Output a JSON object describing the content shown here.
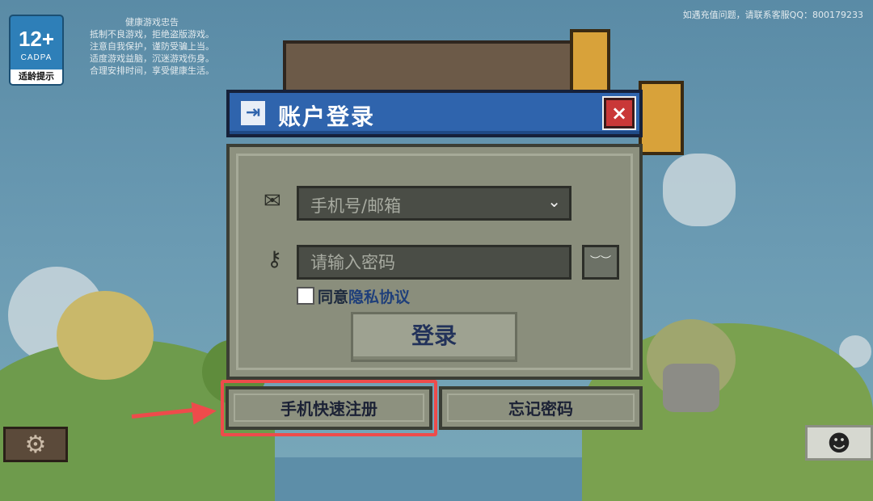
{
  "age_rating": {
    "number": "12+",
    "org": "CADPA",
    "caption": "适龄提示"
  },
  "health_notice": {
    "title": "健康游戏忠告",
    "lines": [
      "抵制不良游戏，拒绝盗版游戏。",
      "注意自我保护，谨防受骗上当。",
      "适度游戏益脑，沉迷游戏伤身。",
      "合理安排时间，享受健康生活。"
    ]
  },
  "support_text": "如遇充值问题，请联系客服QQ：800179233",
  "dialog": {
    "title": "账户登录",
    "close_icon": "×",
    "account_placeholder": "手机号/邮箱",
    "password_placeholder": "请输入密码",
    "eye_icon": "︶︶",
    "agree_prefix": "同意",
    "agree_link": "隐私协议",
    "login_button": "登录",
    "register_button": "手机快速注册",
    "forgot_button": "忘记密码"
  },
  "icons": {
    "login": "⇥",
    "mail": "✉",
    "key": "⚷",
    "chevron_down": "⌄",
    "settings": "⚙",
    "avatar": "☻"
  },
  "colors": {
    "header_blue": "#2f64ad",
    "panel": "#8d917f",
    "highlight_red": "#ee4b4b"
  }
}
